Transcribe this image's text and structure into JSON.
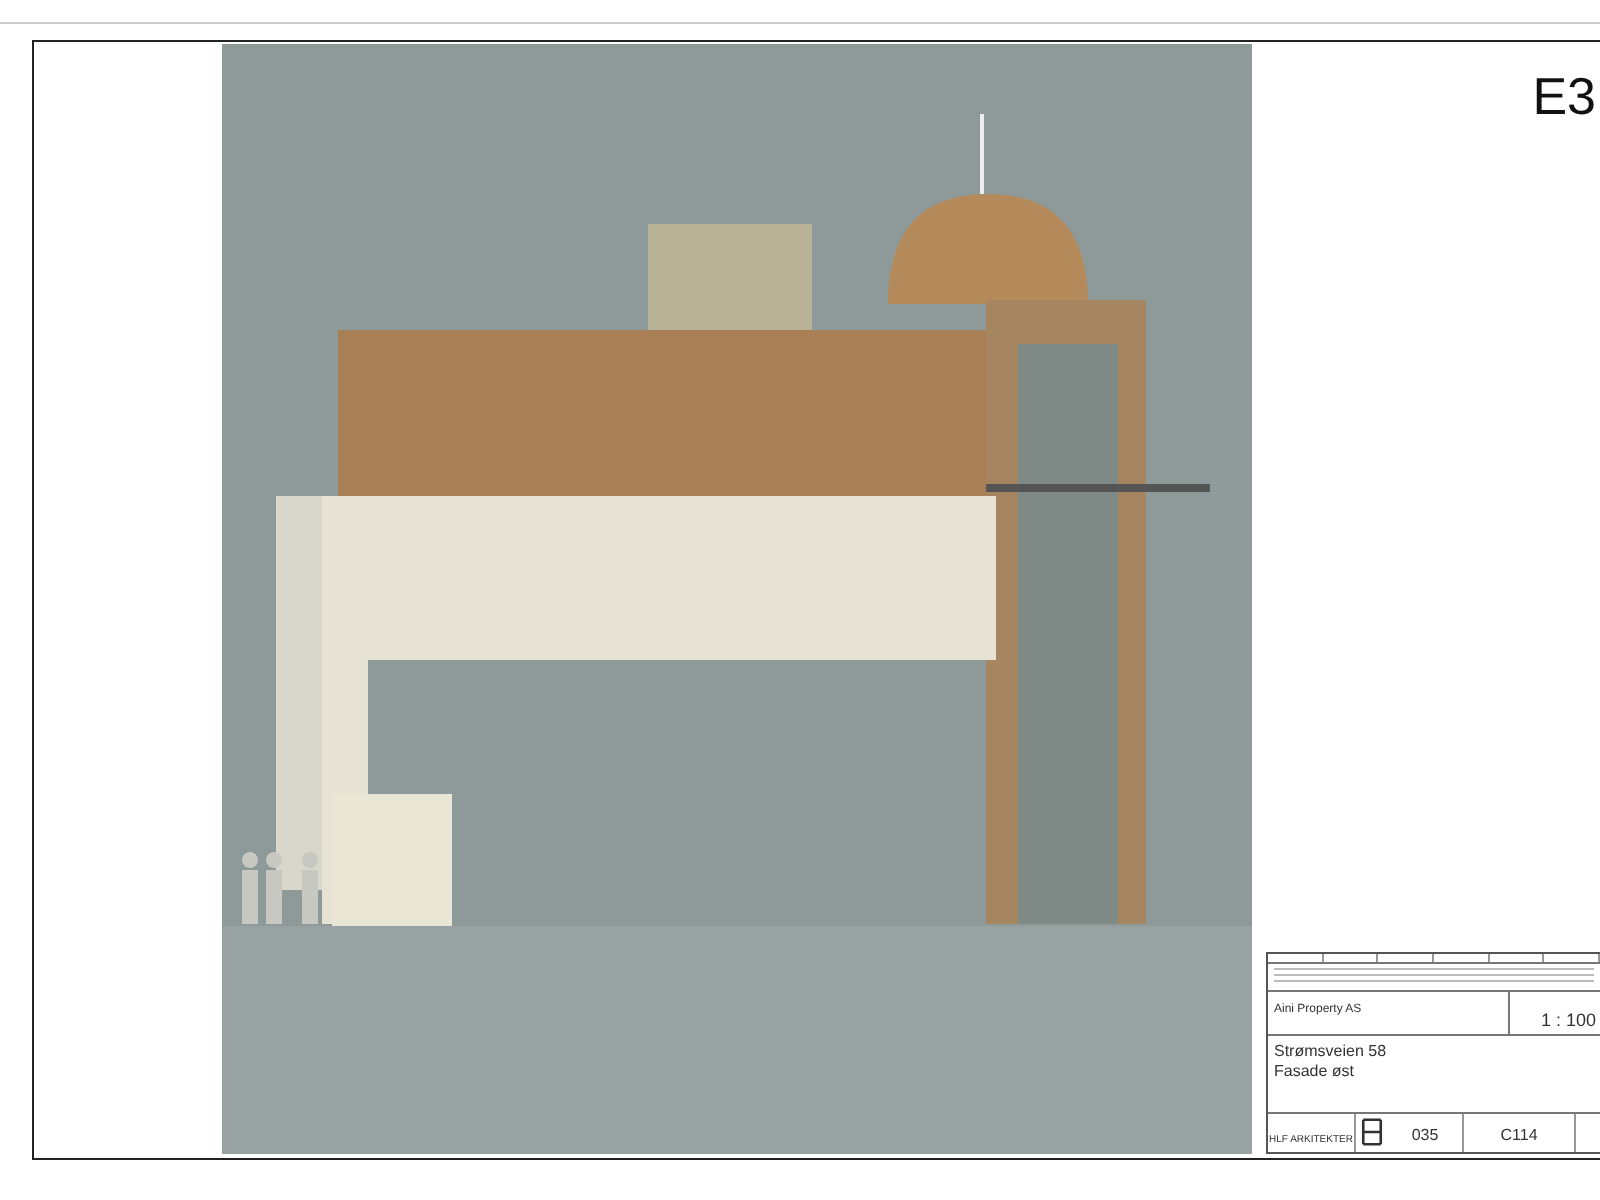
{
  "sheet": {
    "sheet_number": "E3"
  },
  "title_block": {
    "client": "Aini Property AS",
    "scale": "1 : 100",
    "project": "Strømsveien 58",
    "drawing_title": "Fasade øst",
    "architect": "HLF ARKITEKTER",
    "project_number": "035",
    "drawing_number": "C114"
  }
}
